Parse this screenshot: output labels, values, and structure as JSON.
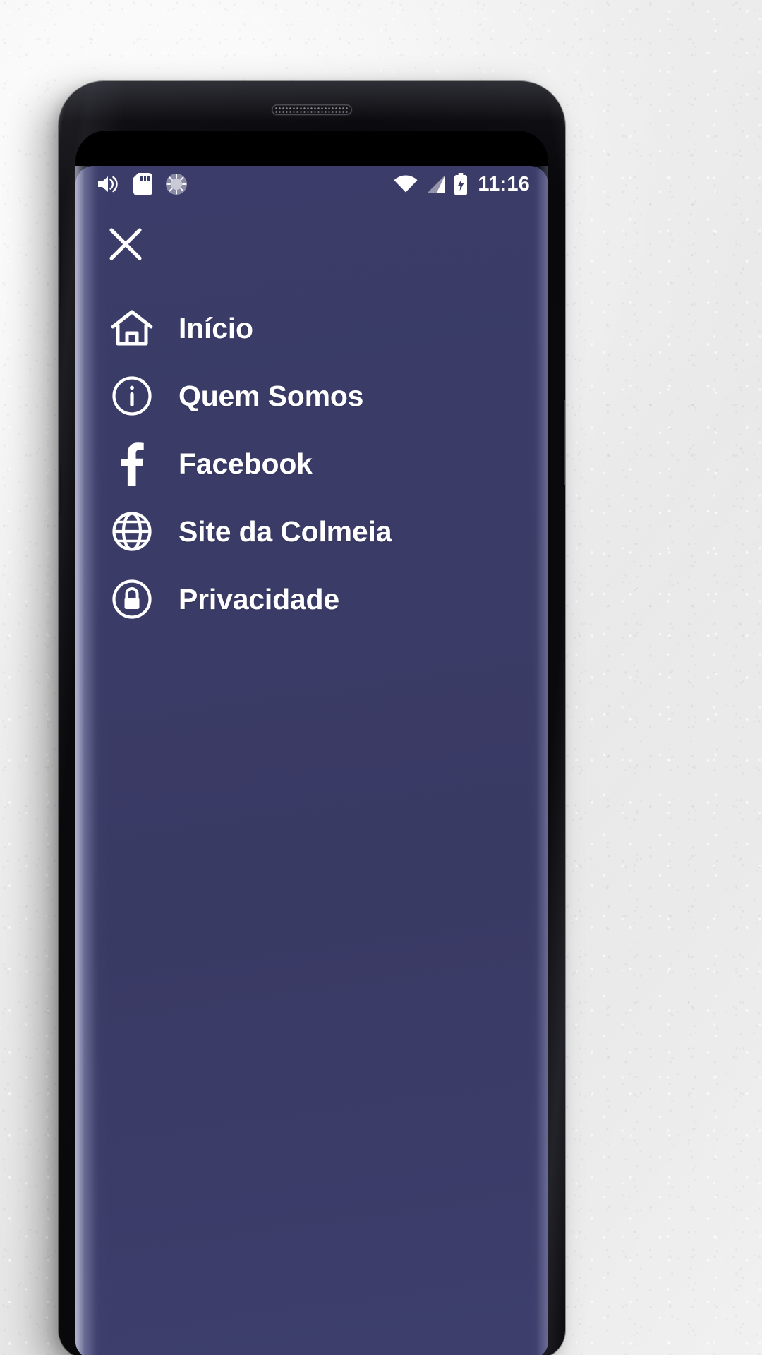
{
  "device": {
    "type": "android-smartphone-mockup",
    "earpiece": "earpiece-speaker"
  },
  "statusbar": {
    "time": "11:16",
    "left_icons": [
      {
        "name": "volume-icon",
        "label": "Volume"
      },
      {
        "name": "sd-card-icon",
        "label": "SD Card"
      },
      {
        "name": "sync-icon",
        "label": "Sync"
      }
    ],
    "right_icons": [
      {
        "name": "wifi-icon",
        "label": "Wi-Fi"
      },
      {
        "name": "signal-icon",
        "label": "Mobile signal"
      },
      {
        "name": "battery-charging-icon",
        "label": "Battery charging"
      }
    ]
  },
  "drawer": {
    "close_label": "Fechar",
    "background_color": "#3a3b66",
    "text_color": "#ffffff",
    "items": [
      {
        "label": "Início",
        "icon": "home-icon"
      },
      {
        "label": "Quem Somos",
        "icon": "info-circle-icon"
      },
      {
        "label": "Facebook",
        "icon": "facebook-icon"
      },
      {
        "label": "Site da Colmeia",
        "icon": "globe-icon"
      },
      {
        "label": "Privacidade",
        "icon": "lock-circle-icon"
      }
    ]
  }
}
